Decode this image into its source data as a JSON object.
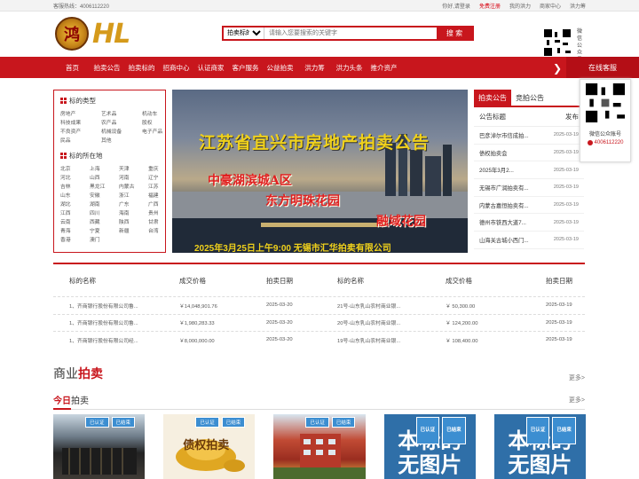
{
  "topbar": {
    "hotline": "客服热线：4006112220",
    "greeting": "你好,请登录",
    "register": "免费注册",
    "my": "我的洪力",
    "merchant": "商家中心",
    "platform": "洪力筹"
  },
  "logo": {
    "mark": "鸿",
    "text": "HL"
  },
  "search": {
    "select": "拍卖标的",
    "placeholder": "请输入您要搜索的关键字",
    "button": "搜 索"
  },
  "qr_label": "微信公众号",
  "nav": {
    "items": [
      "首页",
      "拍卖公告",
      "拍卖标的",
      "招商中心",
      "认证商家",
      "客户服务",
      "公益拍卖",
      "洪力筹",
      "洪力头条",
      "推介资产"
    ],
    "online": "在线客服"
  },
  "categories": {
    "type_title": "标的类型",
    "types": [
      "房地产",
      "艺术品",
      "机动车",
      "科技成果",
      "农产品",
      "股权",
      "不良资产",
      "机械设备",
      "电子产品",
      "民品",
      "其他"
    ],
    "loc_title": "标的所在地",
    "locations": [
      "北京",
      "上海",
      "天津",
      "重庆",
      "河北",
      "山西",
      "河南",
      "辽宁",
      "吉林",
      "黑龙江",
      "内蒙古",
      "江苏",
      "山东",
      "安徽",
      "浙江",
      "福建",
      "湖北",
      "湖南",
      "广东",
      "广西",
      "江西",
      "四川",
      "海南",
      "贵州",
      "云南",
      "西藏",
      "陕西",
      "甘肃",
      "青海",
      "宁夏",
      "新疆",
      "台湾",
      "香港",
      "澳门"
    ]
  },
  "banner": {
    "title": "江苏省宜兴市房地产拍卖公告",
    "line1": "中豪湖滨城A区",
    "line2": "东方明珠花园",
    "line3": "融域花园",
    "footer": "2025年3月25日上午9:00  无锡市汇华拍卖有限公司"
  },
  "notice": {
    "tab_active": "拍卖公告",
    "tab_2": "竞拍公告",
    "col_title": "公告标题",
    "col_date": "发布",
    "rows": [
      {
        "title": "巴彦淖尔市信成拍...",
        "date": "2025-03-19"
      },
      {
        "title": "债权拍卖会",
        "date": "2025-03-19"
      },
      {
        "title": "2025年3月2...",
        "date": "2025-03-19"
      },
      {
        "title": "无锡市广润拍卖有...",
        "date": "2025-03-19"
      },
      {
        "title": "内蒙古嘉恒拍卖有...",
        "date": "2025-03-19"
      },
      {
        "title": "德州市铁西大道7...",
        "date": "2025-03-19"
      },
      {
        "title": "山海关古城小西门...",
        "date": "2025-03-19"
      }
    ]
  },
  "float": {
    "label": "微信公众账号",
    "phone": "4006112220"
  },
  "results": {
    "headers": [
      "标的名称",
      "成交价格",
      "拍卖日期",
      "标的名称",
      "成交价格",
      "拍卖日期"
    ],
    "rows": [
      {
        "n1": "1、齐商银行股份有限公司鲁...",
        "p1": "￥14,048,901.76",
        "d1": "2025-03-20",
        "n2": "21号-山东乳山农村商业银...",
        "p2": "￥ 50,300.00",
        "d2": "2025-03-19"
      },
      {
        "n1": "1、齐商银行股份有限公司鲁...",
        "p1": "￥1,980,283.33",
        "d1": "2025-03-20",
        "n2": "20号-山东乳山农村商业银...",
        "p2": "￥ 124,200.00",
        "d2": "2025-03-19"
      },
      {
        "n1": "1、齐商银行股份有限公司经...",
        "p1": "￥8,000,000.00",
        "d1": "2025-03-20",
        "n2": "19号-山东乳山农村商业银...",
        "p2": "￥ 108,400.00",
        "d2": "2025-03-19"
      }
    ]
  },
  "section": {
    "title_plain": "商业",
    "title_red": "拍卖",
    "more": "更多>"
  },
  "today": {
    "title_red": "今日",
    "title_plain": "拍卖",
    "more": "更多>"
  },
  "cards": [
    {
      "b1": "已认证",
      "b2": "已结束"
    },
    {
      "b1": "已认证",
      "b2": "已结束",
      "text": "债权拍卖"
    },
    {
      "b1": "已认证",
      "b2": "已结束"
    },
    {
      "b1": "已认证",
      "b2": "已结束",
      "text1": "本标的",
      "text2": "无图片"
    },
    {
      "b1": "已认证",
      "b2": "已结束",
      "text1": "本标的",
      "text2": "无图片"
    }
  ],
  "colors": {
    "brand": "#c8161d",
    "badge": "#3c8ed1",
    "logo_gold": "#d59a1b"
  }
}
